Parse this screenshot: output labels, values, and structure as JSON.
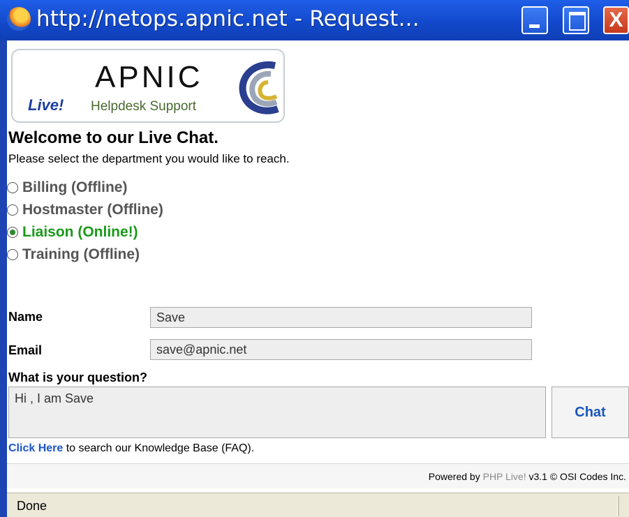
{
  "window": {
    "title": "http://netops.apnic.net - Request...",
    "buttons": [
      "minimize",
      "maximize",
      "close"
    ],
    "close_glyph": "X"
  },
  "logo": {
    "name": "APNIC",
    "live": "Live!",
    "tagline": "Helpdesk Support",
    "swirl_icon": "apnic-swirl-icon"
  },
  "welcome": "Welcome to our Live Chat.",
  "subtitle": "Please select the department you would like to reach.",
  "departments": [
    {
      "label": "Billing (Offline)",
      "selected": false,
      "online": false
    },
    {
      "label": "Hostmaster (Offline)",
      "selected": false,
      "online": false
    },
    {
      "label": "Liaison (Online!)",
      "selected": true,
      "online": true
    },
    {
      "label": "Training (Offline)",
      "selected": false,
      "online": false
    }
  ],
  "form": {
    "name_label": "Name",
    "name_value": "Save",
    "email_label": "Email",
    "email_value": "save@apnic.net",
    "question_label": "What is your question?",
    "question_value": "Hi , I am Save",
    "chat_button": "Chat"
  },
  "knowledge_base": {
    "link": "Click Here",
    "text": " to search our Knowledge Base (FAQ)."
  },
  "footer": {
    "powered_prefix": "Powered by ",
    "powered_link": "PHP Live!",
    "powered_suffix": " v3.1 © OSI Codes Inc."
  },
  "status": "Done",
  "colors": {
    "titlebar": "#1248c9",
    "online_green": "#1a9a1a",
    "link_blue": "#1a55c8",
    "offline_gray": "#555555"
  }
}
